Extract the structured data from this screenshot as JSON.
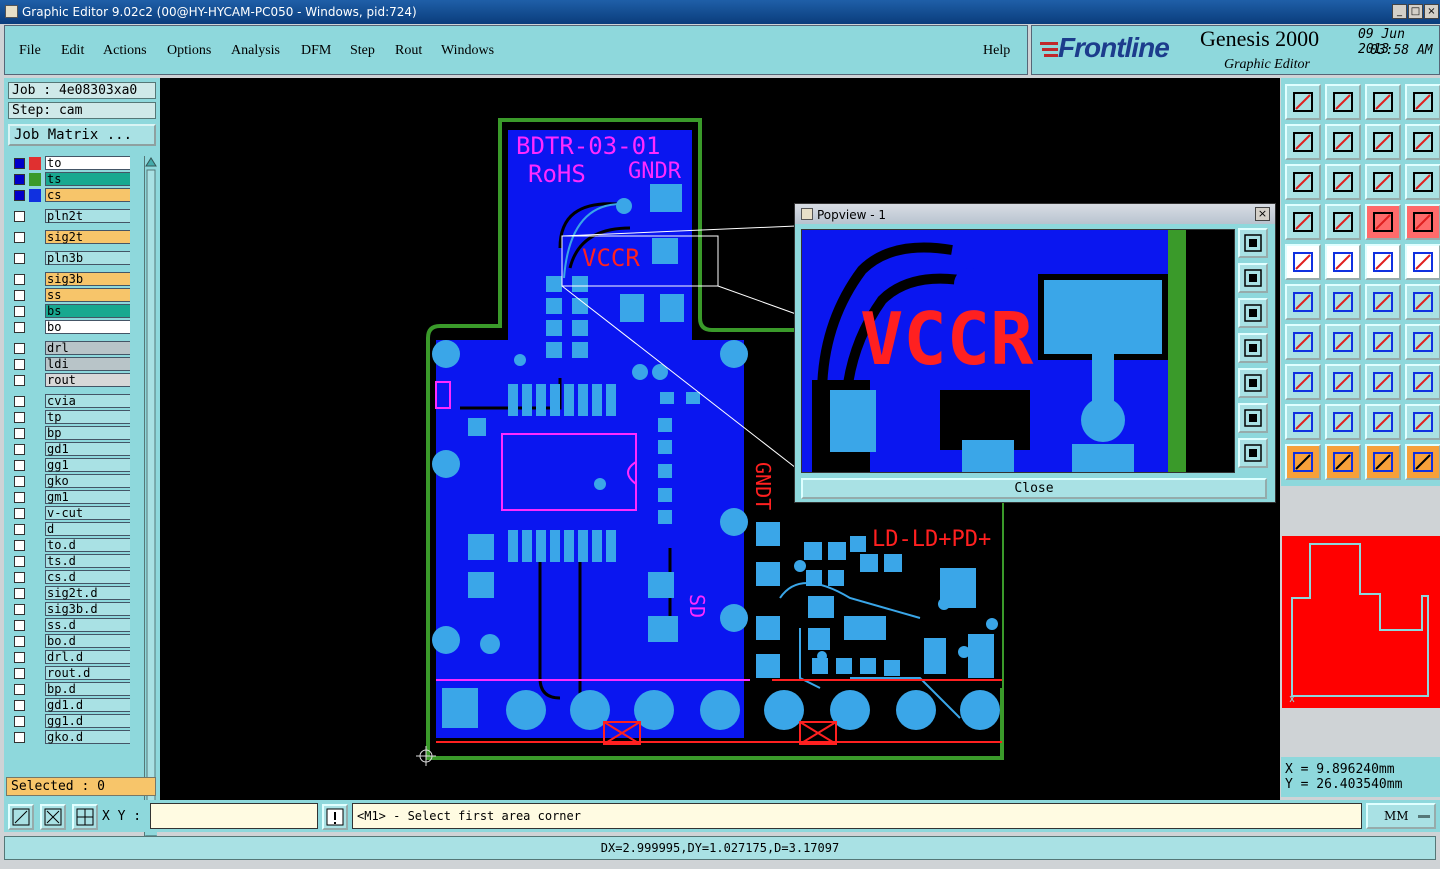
{
  "window": {
    "title": "Graphic Editor 9.02c2 (00@HY-HYCAM-PC050 - Windows, pid:724)",
    "buttons": [
      "_",
      "□",
      "×"
    ]
  },
  "menu": {
    "items": [
      "File",
      "Edit",
      "Actions",
      "Options",
      "Analysis",
      "DFM",
      "Step",
      "Rout",
      "Windows"
    ],
    "help": "Help"
  },
  "brand": {
    "logo": "Frontline",
    "product": "Genesis 2000",
    "subtitle": "Graphic Editor",
    "date": "09 Jun 2013",
    "time": "03:58 AM"
  },
  "left": {
    "job": "Job : 4e08303xa0",
    "step": "Step: cam",
    "job_matrix": "Job Matrix ...",
    "layers": [
      {
        "name": "to",
        "color": "#ffffff",
        "swatch": "#e03030",
        "checked": true
      },
      {
        "name": "ts",
        "color": "#18a890",
        "swatch": "#3a9a2a",
        "checked": true
      },
      {
        "name": "cs",
        "color": "#f7c56a",
        "swatch": "#1030e0",
        "checked": true
      },
      {
        "name": "pln2t",
        "color": "#a9e1e4",
        "checked": false
      },
      {
        "name": "sig2t",
        "color": "#f7c56a",
        "checked": false
      },
      {
        "name": "pln3b",
        "color": "#a9e1e4",
        "checked": false
      },
      {
        "name": "sig3b",
        "color": "#f7c56a",
        "checked": false
      },
      {
        "name": "ss",
        "color": "#f7c56a",
        "checked": false
      },
      {
        "name": "bs",
        "color": "#18a890",
        "checked": false
      },
      {
        "name": "bo",
        "color": "#ffffff",
        "checked": false
      },
      {
        "name": "drl",
        "color": "#b8c4c8",
        "checked": false
      },
      {
        "name": "ldi",
        "color": "#b8c4c8",
        "checked": false
      },
      {
        "name": "rout",
        "color": "#d8d8d8",
        "checked": false
      },
      {
        "name": "cvia",
        "color": "#a9e1e4",
        "checked": false
      },
      {
        "name": "tp",
        "color": "#a9e1e4",
        "checked": false
      },
      {
        "name": "bp",
        "color": "#a9e1e4",
        "checked": false
      },
      {
        "name": "gd1",
        "color": "#a9e1e4",
        "checked": false
      },
      {
        "name": "gg1",
        "color": "#a9e1e4",
        "checked": false
      },
      {
        "name": "gko",
        "color": "#a9e1e4",
        "checked": false
      },
      {
        "name": "gm1",
        "color": "#a9e1e4",
        "checked": false
      },
      {
        "name": "v-cut",
        "color": "#a9e1e4",
        "checked": false
      },
      {
        "name": "d",
        "color": "#a9e1e4",
        "checked": false
      },
      {
        "name": "to.d",
        "color": "#a9e1e4",
        "checked": false
      },
      {
        "name": "ts.d",
        "color": "#a9e1e4",
        "checked": false
      },
      {
        "name": "cs.d",
        "color": "#a9e1e4",
        "checked": false
      },
      {
        "name": "sig2t.d",
        "color": "#a9e1e4",
        "checked": false
      },
      {
        "name": "sig3b.d",
        "color": "#a9e1e4",
        "checked": false
      },
      {
        "name": "ss.d",
        "color": "#a9e1e4",
        "checked": false
      },
      {
        "name": "bo.d",
        "color": "#a9e1e4",
        "checked": false
      },
      {
        "name": "drl.d",
        "color": "#a9e1e4",
        "checked": false
      },
      {
        "name": "rout.d",
        "color": "#a9e1e4",
        "checked": false
      },
      {
        "name": "bp.d",
        "color": "#a9e1e4",
        "checked": false
      },
      {
        "name": "gd1.d",
        "color": "#a9e1e4",
        "checked": false
      },
      {
        "name": "gg1.d",
        "color": "#a9e1e4",
        "checked": false
      },
      {
        "name": "gko.d",
        "color": "#a9e1e4",
        "checked": false
      }
    ],
    "selected": "Selected : 0"
  },
  "board": {
    "labels": {
      "part": "BDTR-03-01",
      "rohs": "RoHS",
      "gndr": "GNDR",
      "vccr": "VCCR",
      "gndt": "GNDT",
      "sd": "SD",
      "ld": "LD-LD+PD+"
    },
    "colors": {
      "copper": "#0a16f0",
      "pad": "#3aa6e8",
      "outline": "#3a9a2a",
      "silk_magenta": "#ff2aff",
      "silk_red": "#ff2020"
    }
  },
  "popview": {
    "title": "Popview - 1",
    "label": "VCCR",
    "close": "Close"
  },
  "coords": {
    "x": "X = 9.896240mm",
    "y": "Y = 26.403540mm"
  },
  "command": {
    "xy_label": "X Y :",
    "xy_value": "",
    "prompt": "<M1> - Select first area corner",
    "units": "MM"
  },
  "status": "DX=2.999995,DY=1.027175,D=3.17097"
}
